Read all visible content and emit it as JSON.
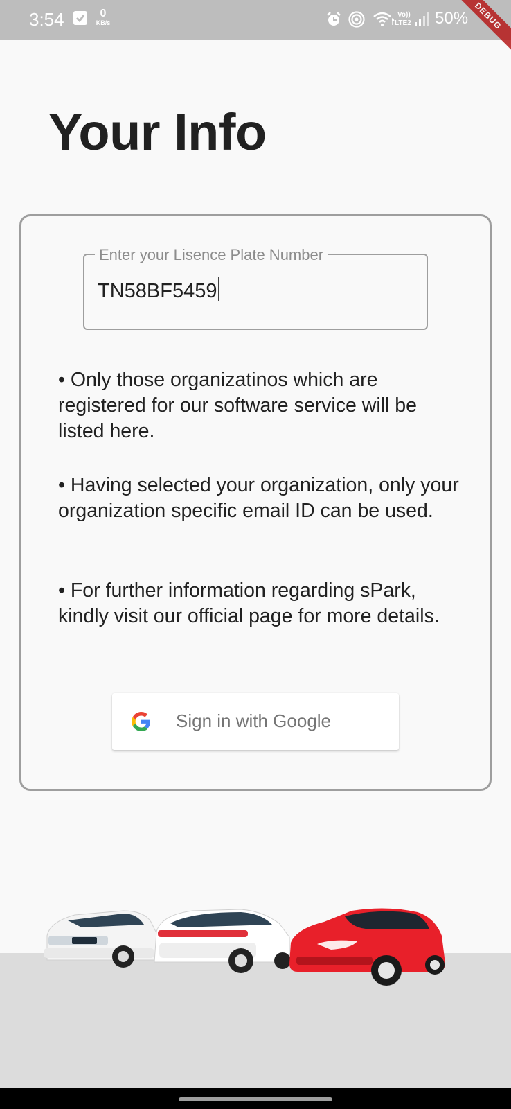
{
  "status_bar": {
    "time": "3:54",
    "speed_value": "0",
    "speed_unit": "KB/s",
    "battery": "50%",
    "icons": [
      "check-box-icon",
      "alarm-icon",
      "hotspot-icon",
      "wifi-icon",
      "volte-icon",
      "signal-icon"
    ]
  },
  "debug_banner": "DEBUG",
  "page": {
    "title": "Your Info"
  },
  "plate_field": {
    "label": "Enter your Lisence Plate Number",
    "value": "TN58BF5459"
  },
  "bullets": [
    "• Only those organizatinos which are registered for our software service will be listed here.",
    "• Having selected your organization, only your organization specific email ID can be used.",
    "• For further information regarding sPark, kindly visit our official page for more details."
  ],
  "google_button": {
    "label": "Sign in with Google",
    "icon": "google-g-icon"
  },
  "colors": {
    "status_bar": "#bdbdbd",
    "background": "#f9f9f9",
    "title": "#212121",
    "card_border": "#9e9e9e",
    "ground": "#dcdcdc",
    "car_red": "#e8202a"
  }
}
